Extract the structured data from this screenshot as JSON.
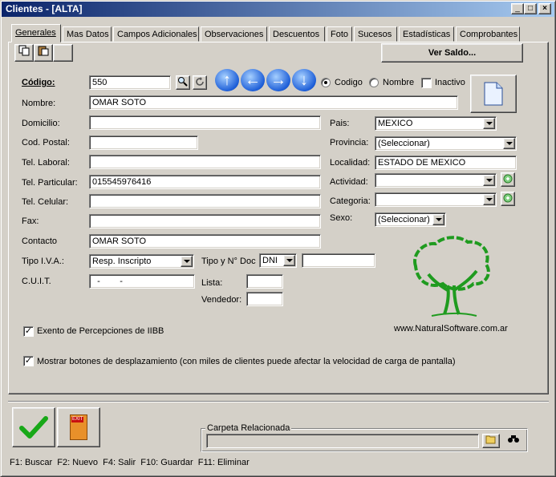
{
  "window": {
    "title": "Clientes - [ALTA]",
    "min": "_",
    "max": "□",
    "close": "×"
  },
  "tabs": [
    "Generales",
    "Mas Datos",
    "Campos Adicionales",
    "Observaciones",
    "Descuentos",
    "Foto",
    "Sucesos",
    "Estadísticas",
    "Comprobantes"
  ],
  "toolbar": {
    "ver_saldo": "Ver Saldo..."
  },
  "codigo": {
    "label": "Código:",
    "value": "550"
  },
  "search_by": {
    "codigo": "Codigo",
    "nombre": "Nombre",
    "inactivo": "Inactivo"
  },
  "fields": {
    "nombre": {
      "label": "Nombre:",
      "value": "OMAR SOTO"
    },
    "domicilio": {
      "label": "Domicilio:",
      "value": ""
    },
    "cod_postal": {
      "label": "Cod. Postal:",
      "value": ""
    },
    "tel_laboral": {
      "label": "Tel. Laboral:",
      "value": ""
    },
    "tel_particular": {
      "label": "Tel. Particular:",
      "value": "015545976416"
    },
    "tel_celular": {
      "label": "Tel. Celular:",
      "value": ""
    },
    "fax": {
      "label": "Fax:",
      "value": ""
    },
    "contacto": {
      "label": "Contacto",
      "value": "OMAR SOTO"
    },
    "tipo_iva": {
      "label": "Tipo I.V.A.:",
      "value": "Resp. Inscripto"
    },
    "tipo_doc": {
      "label": "Tipo y N° Doc",
      "type": "DNI",
      "number": ""
    },
    "cuit": {
      "label": "C.U.I.T.",
      "value": "  -        -  "
    },
    "lista": {
      "label": "Lista:",
      "value": ""
    },
    "vendedor": {
      "label": "Vendedor:",
      "value": ""
    },
    "pais": {
      "label": "Pais:",
      "value": "MEXICO"
    },
    "provincia": {
      "label": "Provincia:",
      "value": "(Seleccionar)"
    },
    "localidad": {
      "label": "Localidad:",
      "value": "ESTADO DE MEXICO"
    },
    "actividad": {
      "label": "Actividad:",
      "value": ""
    },
    "categoria": {
      "label": "Categoria:",
      "value": ""
    },
    "sexo": {
      "label": "Sexo:",
      "value": "(Seleccionar)"
    }
  },
  "logo": {
    "url_text": "www.NaturalSoftware.com.ar",
    "color": "#1f9b1f"
  },
  "checks": {
    "exento": "Exento de Percepciones de IIBB",
    "mostrar": "Mostrar botones de desplazamiento  (con miles de clientes puede afectar la velocidad de carga de pantalla)"
  },
  "exit_label": "EXIT",
  "carpeta": {
    "label": "Carpeta Relacionada",
    "value": ""
  },
  "shortcuts": "F1: Buscar  F2: Nuevo  F4: Salir  F10: Guardar  F11: Eliminar"
}
